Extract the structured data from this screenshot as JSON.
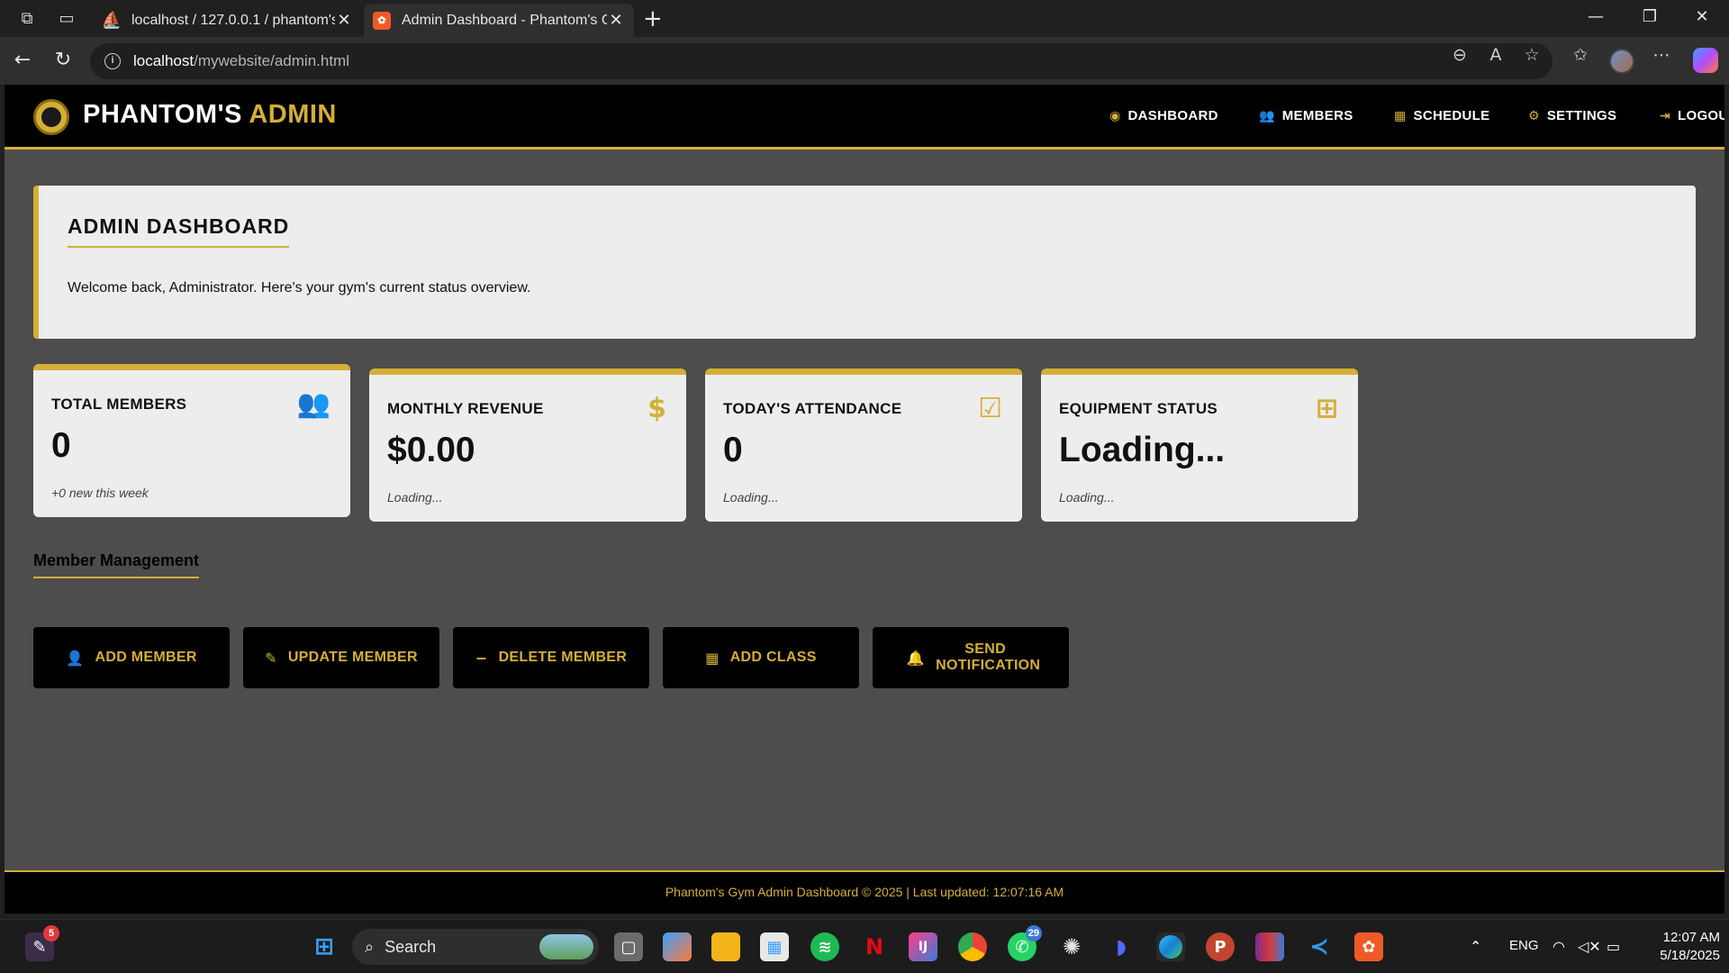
{
  "browser": {
    "tabs": [
      {
        "title": "localhost / 127.0.0.1 / phantom's",
        "active": false
      },
      {
        "title": "Admin Dashboard - Phantom's Gym",
        "active": true
      }
    ],
    "url_host": "localhost",
    "url_path": "/mywebsite/admin.html"
  },
  "header": {
    "brand_white": "PHANTOM'S",
    "brand_gold": "ADMIN",
    "nav": [
      {
        "label": "DASHBOARD",
        "icon": "gauge-icon"
      },
      {
        "label": "MEMBERS",
        "icon": "users-icon"
      },
      {
        "label": "SCHEDULE",
        "icon": "calendar-icon"
      },
      {
        "label": "SETTINGS",
        "icon": "gear-icon"
      },
      {
        "label": "LOGOUT",
        "icon": "logout-icon"
      }
    ]
  },
  "welcome": {
    "title": "ADMIN DASHBOARD",
    "message": "Welcome back, Administrator. Here's your gym's current status overview."
  },
  "stats": [
    {
      "title": "TOTAL MEMBERS",
      "value": "0",
      "sub": "+0 new this week",
      "icon": "users-icon"
    },
    {
      "title": "MONTHLY REVENUE",
      "value": "$0.00",
      "sub": "Loading...",
      "icon": "dollar-icon"
    },
    {
      "title": "TODAY'S ATTENDANCE",
      "value": "0",
      "sub": "Loading...",
      "icon": "clipboard-check-icon"
    },
    {
      "title": "EQUIPMENT STATUS",
      "value": "Loading...",
      "sub": "Loading...",
      "icon": "dumbbell-icon"
    }
  ],
  "member_management": {
    "title": "Member Management",
    "actions": [
      {
        "label": "ADD MEMBER",
        "icon": "user-plus-icon"
      },
      {
        "label": "UPDATE MEMBER",
        "icon": "user-edit-icon"
      },
      {
        "label": "DELETE MEMBER",
        "icon": "user-minus-icon"
      },
      {
        "label": "ADD CLASS",
        "icon": "calendar-plus-icon"
      },
      {
        "label": "SEND NOTIFICATION",
        "icon": "bell-icon"
      }
    ]
  },
  "footer": {
    "text": "Phantom's Gym Admin Dashboard © 2025 | Last updated: 12:07:16 AM"
  },
  "taskbar": {
    "search_placeholder": "Search",
    "notification_count": "5",
    "whatsapp_badge": "29",
    "language": "ENG",
    "time": "12:07 AM",
    "date": "5/18/2025"
  },
  "colors": {
    "gold": "#d4af37",
    "black": "#000000",
    "page_bg": "#4d4d4d",
    "card_bg": "#ededed"
  }
}
